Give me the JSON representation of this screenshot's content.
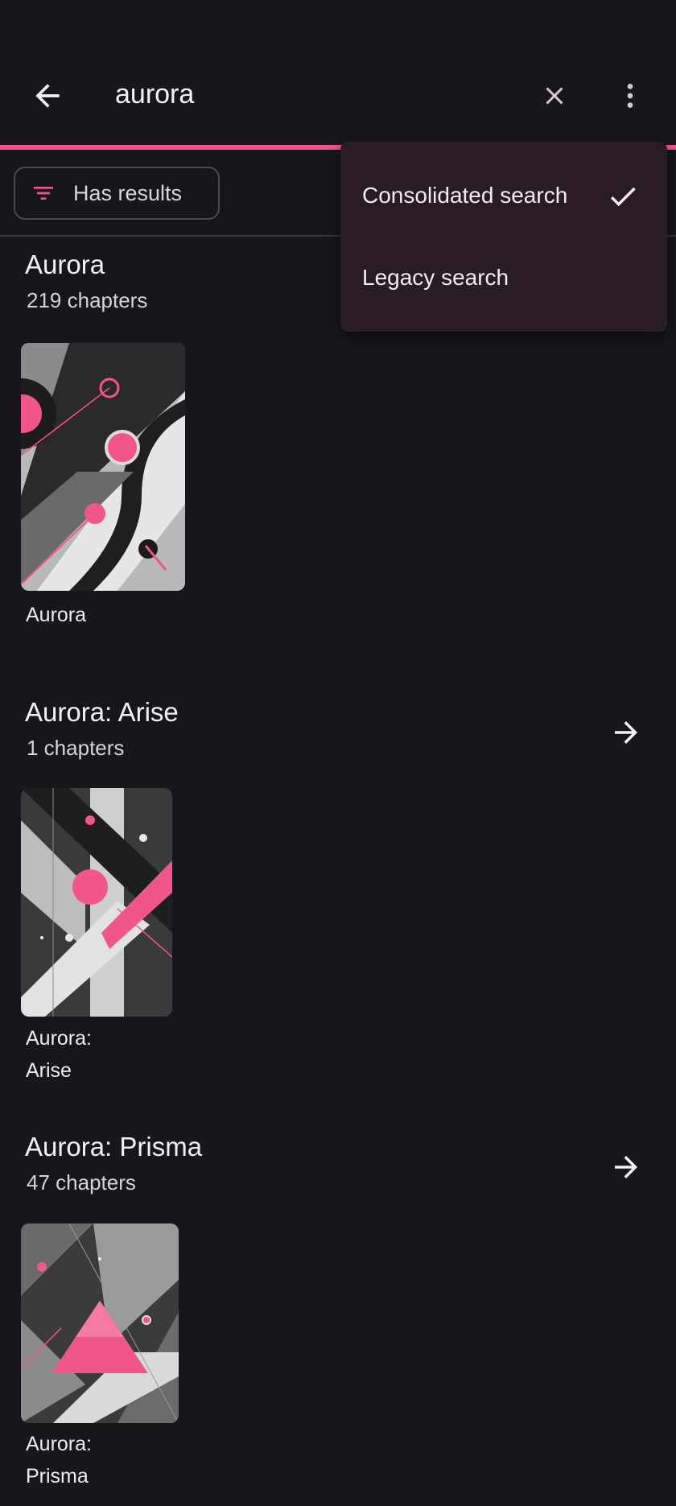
{
  "search": {
    "query": "aurora"
  },
  "filter": {
    "chip_label": "Has results"
  },
  "menu": {
    "items": [
      {
        "label": "Consolidated search",
        "checked": true
      },
      {
        "label": "Legacy search",
        "checked": false
      }
    ]
  },
  "sections": [
    {
      "title": "Aurora",
      "subtitle": "219 chapters",
      "cover_label_line1": "Aurora",
      "cover_label_line2": ""
    },
    {
      "title": "Aurora: Arise",
      "subtitle": "1 chapters",
      "cover_label_line1": "Aurora:",
      "cover_label_line2": "Arise"
    },
    {
      "title": "Aurora: Prisma",
      "subtitle": "47 chapters",
      "cover_label_line1": "Aurora:",
      "cover_label_line2": "Prisma"
    }
  ],
  "colors": {
    "accent": "#f0568a",
    "background": "#17161b",
    "menu_bg": "#2a1c26"
  },
  "icons": {
    "back": "arrow-left-icon",
    "clear": "close-icon",
    "more": "more-vert-icon",
    "filter": "filter-icon",
    "check": "check-icon",
    "forward": "arrow-right-icon"
  }
}
